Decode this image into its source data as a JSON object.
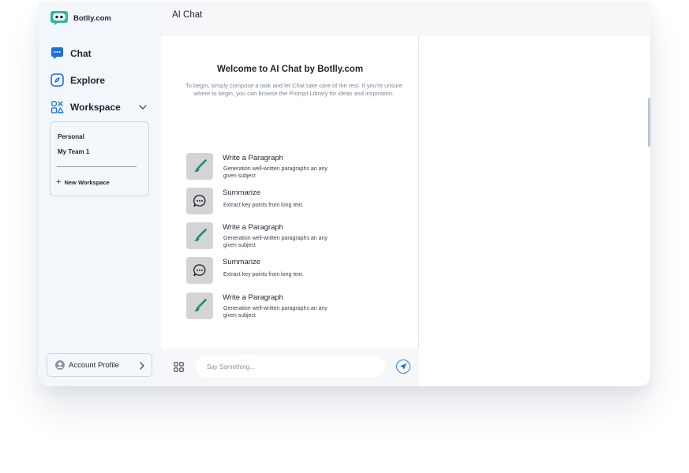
{
  "brand": {
    "name": "Botlly.com",
    "logo": "robot-face-logo",
    "accent": "#2fb5a0"
  },
  "nav": {
    "chat": {
      "label": "Chat",
      "icon": "chat-bubble-icon"
    },
    "explore": {
      "label": "Explore",
      "icon": "compass-icon"
    },
    "workspace": {
      "label": "Workspace",
      "icon": "shapes-grid-icon"
    }
  },
  "workspace": {
    "items": [
      "Personal",
      "My Team 1"
    ],
    "new_label": "New Workspace"
  },
  "account": {
    "label": "Account Profile"
  },
  "header": {
    "title": "AI Chat"
  },
  "welcome": {
    "title": "Welcome to AI Chat by Botlly.com",
    "description": "To begin, simply compose a task and let Chat take care of the rest. If you're unsure where to begin, you can browse the Prompt Library for ideas and inspiration."
  },
  "prompts": [
    {
      "title": "Write a Paragraph",
      "description": "Generation well-written paragraphs an any given subject",
      "icon": "brush-icon"
    },
    {
      "title": "Summarize",
      "description": "Extract key points from long text.",
      "icon": "speech-bubble-icon"
    },
    {
      "title": "Write a Paragraph",
      "description": "Generation well-written paragraphs an any given subject",
      "icon": "brush-icon"
    },
    {
      "title": "Summarize",
      "description": "Extract key points from long text.",
      "icon": "speech-bubble-icon"
    },
    {
      "title": "Write a Paragraph",
      "description": "Generation well-written paragraphs an any given subject",
      "icon": "brush-icon"
    }
  ],
  "composer": {
    "placeholder": "Say Something..."
  },
  "colors": {
    "primary": "#1f6fe0",
    "teal": "#1b8a7a",
    "sidebar_bg": "#f1f7fb"
  }
}
